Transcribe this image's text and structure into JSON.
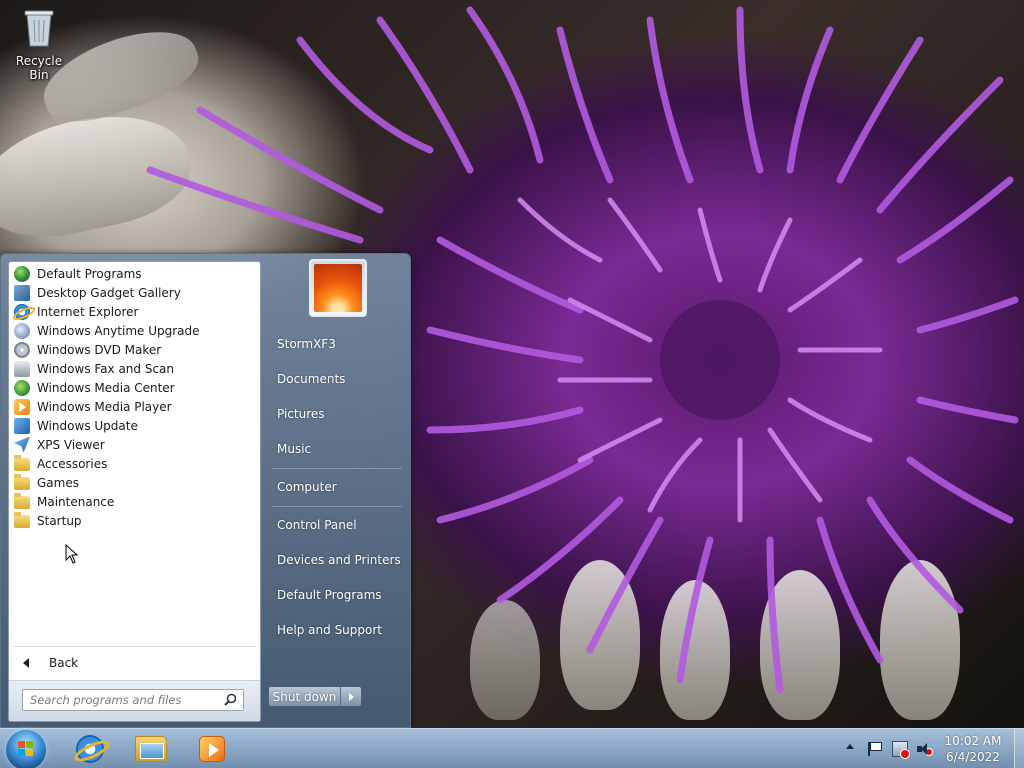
{
  "desktop": {
    "icons": [
      {
        "label": "Recycle Bin",
        "icon": "recycle-bin-icon"
      }
    ]
  },
  "start_menu": {
    "programs": [
      {
        "label": "Default Programs",
        "icon": "default-programs-icon"
      },
      {
        "label": "Desktop Gadget Gallery",
        "icon": "gadget-gallery-icon"
      },
      {
        "label": "Internet Explorer",
        "icon": "internet-explorer-icon"
      },
      {
        "label": "Windows Anytime Upgrade",
        "icon": "anytime-upgrade-icon"
      },
      {
        "label": "Windows DVD Maker",
        "icon": "dvd-maker-icon"
      },
      {
        "label": "Windows Fax and Scan",
        "icon": "fax-scan-icon"
      },
      {
        "label": "Windows Media Center",
        "icon": "media-center-icon"
      },
      {
        "label": "Windows Media Player",
        "icon": "media-player-icon"
      },
      {
        "label": "Windows Update",
        "icon": "windows-update-icon"
      },
      {
        "label": "XPS Viewer",
        "icon": "xps-viewer-icon"
      },
      {
        "label": "Accessories",
        "icon": "folder-icon"
      },
      {
        "label": "Games",
        "icon": "folder-icon"
      },
      {
        "label": "Maintenance",
        "icon": "folder-icon"
      },
      {
        "label": "Startup",
        "icon": "folder-icon"
      }
    ],
    "back_label": "Back",
    "search_placeholder": "Search programs and files",
    "right_items": [
      {
        "label": "StormXF3"
      },
      {
        "label": "Documents"
      },
      {
        "label": "Pictures"
      },
      {
        "label": "Music"
      },
      {
        "label": "Computer"
      },
      {
        "label": "Control Panel"
      },
      {
        "label": "Devices and Printers"
      },
      {
        "label": "Default Programs"
      },
      {
        "label": "Help and Support"
      }
    ],
    "shutdown_label": "Shut down"
  },
  "taskbar": {
    "pinned": [
      {
        "icon": "internet-explorer-icon"
      },
      {
        "icon": "windows-explorer-icon"
      },
      {
        "icon": "media-player-icon"
      }
    ],
    "tray_icons": [
      "show-hidden-icons-icon",
      "action-center-flag-icon",
      "network-icon",
      "volume-muted-icon"
    ],
    "clock": {
      "time": "10:02 AM",
      "date": "6/4/2022"
    }
  },
  "colors": {
    "start_orb": "#3d8fd6",
    "taskbar": "#8ca8c6",
    "wallpaper_accent": "#8e3ab0"
  }
}
